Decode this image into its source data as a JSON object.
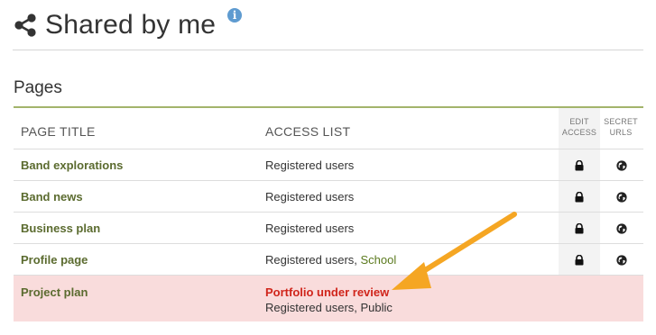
{
  "header": {
    "title": "Shared by me",
    "share_icon": "share-icon",
    "info_icon": "info-icon",
    "info_glyph": "i"
  },
  "section": {
    "heading": "Pages"
  },
  "table": {
    "columns": {
      "title": "PAGE TITLE",
      "access": "ACCESS LIST",
      "edit_access_line1": "EDIT",
      "edit_access_line2": "ACCESS",
      "secret_urls_line1": "SECRET",
      "secret_urls_line2": "URLS"
    },
    "rows": [
      {
        "title": "Band explorations",
        "access": "Registered users",
        "access_extra": ""
      },
      {
        "title": "Band news",
        "access": "Registered users",
        "access_extra": ""
      },
      {
        "title": "Business plan",
        "access": "Registered users",
        "access_extra": ""
      },
      {
        "title": "Profile page",
        "access": "Registered users, ",
        "access_extra": "School"
      }
    ],
    "alert_row": {
      "title": "Project plan",
      "alert": "Portfolio under review",
      "access": "Registered users, Public"
    }
  },
  "colors": {
    "accent": "#a3b46b",
    "title_link": "#5b6b2f",
    "alert_bg": "#f9dcdc",
    "alert_text": "#d0251b",
    "arrow": "#f5a623"
  }
}
